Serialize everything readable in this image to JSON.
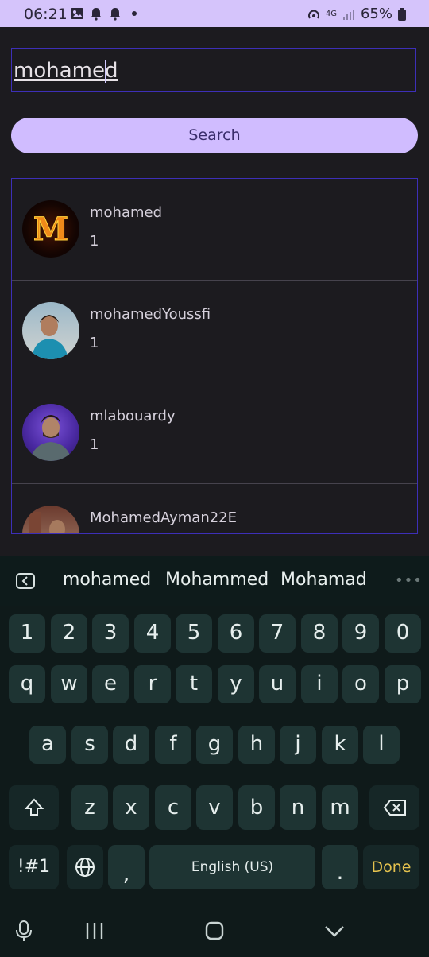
{
  "status_bar": {
    "time": "06:21",
    "battery": "65%",
    "network": "4G"
  },
  "search": {
    "query": "mohamed",
    "button_label": "Search"
  },
  "results": [
    {
      "name": "mohamed",
      "count": "1",
      "avatar": "fire-letter-m-avatar"
    },
    {
      "name": "mohamedYoussfi",
      "count": "1",
      "avatar": "person-avatar"
    },
    {
      "name": "mlabouardy",
      "count": "1",
      "avatar": "person-avatar"
    },
    {
      "name": "MohamedAyman22E",
      "count": "",
      "avatar": "person-avatar"
    }
  ],
  "keyboard": {
    "suggestions": [
      "mohamed",
      "Mohammed",
      "Mohamad"
    ],
    "row_numbers": [
      "1",
      "2",
      "3",
      "4",
      "5",
      "6",
      "7",
      "8",
      "9",
      "0"
    ],
    "row_top": [
      "q",
      "w",
      "e",
      "r",
      "t",
      "y",
      "u",
      "i",
      "o",
      "p"
    ],
    "row_middle": [
      "a",
      "s",
      "d",
      "f",
      "g",
      "h",
      "j",
      "k",
      "l"
    ],
    "row_bottom": [
      "z",
      "x",
      "c",
      "v",
      "b",
      "n",
      "m"
    ],
    "symbols_label": "!#1",
    "comma": ",",
    "space_label": "English (US)",
    "period": ".",
    "done_label": "Done"
  },
  "colors": {
    "status_bar": "#d5c4fb",
    "background": "#1c1b1f",
    "accent": "#d0bcff",
    "border": "#3d2fb8",
    "done": "#e5c24e"
  }
}
